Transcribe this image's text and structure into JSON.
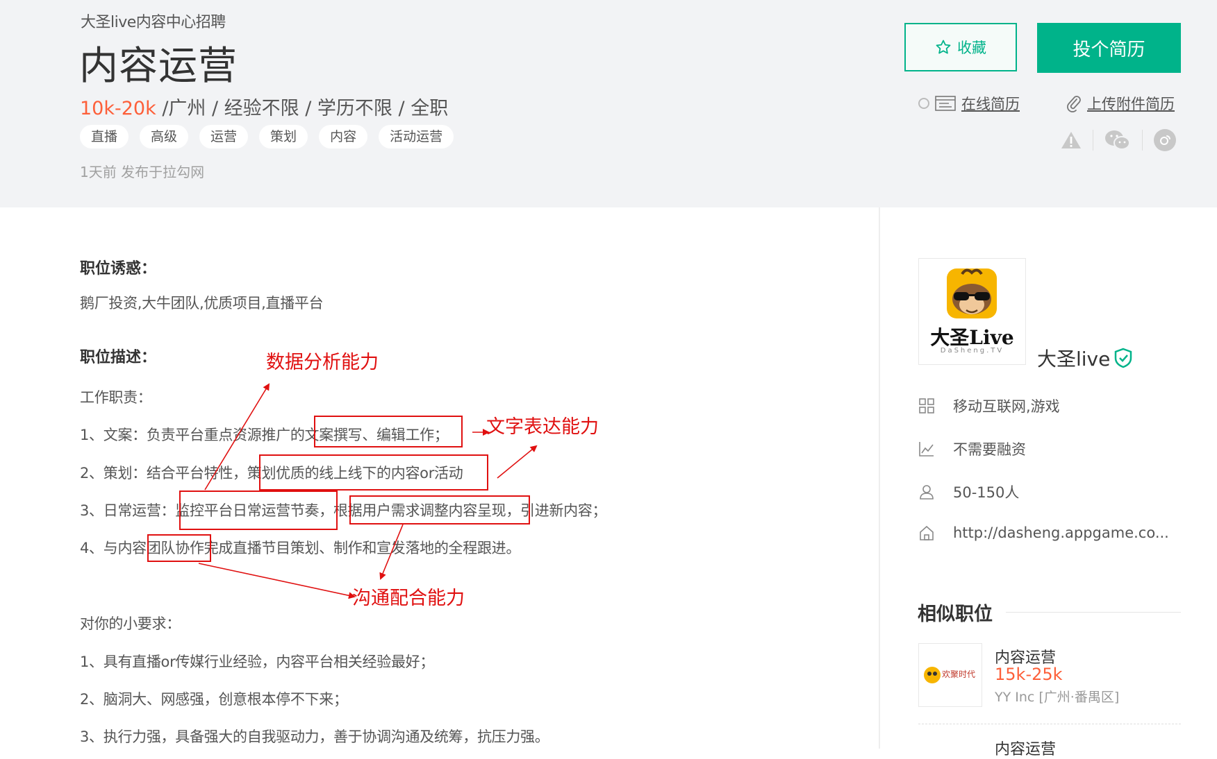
{
  "header": {
    "company_recruit": "大圣live内容中心招聘",
    "job_title": "内容运营",
    "salary": "10k-20k",
    "meta_rest": " /广州 / 经验不限 / 学历不限 / 全职",
    "tags": [
      "直播",
      "高级",
      "运营",
      "策划",
      "内容",
      "活动运营"
    ],
    "posted": "1天前  发布于拉勾网",
    "favorite_label": "收藏",
    "apply_label": "投个简历",
    "online_resume": "在线简历",
    "upload_resume": "上传附件简历"
  },
  "content": {
    "perks_label": "职位诱惑：",
    "perks_text": "鹅厂投资,大牛团队,优质项目,直播平台",
    "desc_label": "职位描述：",
    "duties_label": "工作职责：",
    "duties": [
      "1、文案：负责平台重点资源推广的文案撰写、编辑工作；",
      "2、策划：结合平台特性，策划优质的线上线下的内容or活动",
      "3、日常运营：监控平台日常运营节奏，根据用户需求调整内容呈现，引进新内容；",
      "4、与内容团队协作完成直播节目策划、制作和宣发落地的全程跟进。"
    ],
    "requirements_label": "对你的小要求：",
    "requirements": [
      "1、具有直播or传媒行业经验，内容平台相关经验最好；",
      "2、脑洞大、网感强，创意根本停不下来；",
      "3、执行力强，具备强大的自我驱动力，善于协调沟通及统筹，抗压力强。"
    ]
  },
  "annotations": {
    "data_analysis": "数据分析能力",
    "writing": "文字表达能力",
    "communication": "沟通配合能力"
  },
  "company": {
    "logo_text": "大圣Live",
    "logo_sub": "DaSheng.TV",
    "name": "大圣live",
    "industry": "移动互联网,游戏",
    "funding": "不需要融资",
    "size": "50-150人",
    "website": "http://dasheng.appgame.co..."
  },
  "similar": {
    "title": "相似职位",
    "items": [
      {
        "title": "内容运营",
        "salary": "15k-25k",
        "company": "YY Inc [广州·番禺区]",
        "logo_text": "欢聚时代"
      },
      {
        "title": "内容运营"
      }
    ]
  },
  "colors": {
    "accent": "#00b38a",
    "salary": "#fd5f39",
    "annotation": "#e01010"
  }
}
